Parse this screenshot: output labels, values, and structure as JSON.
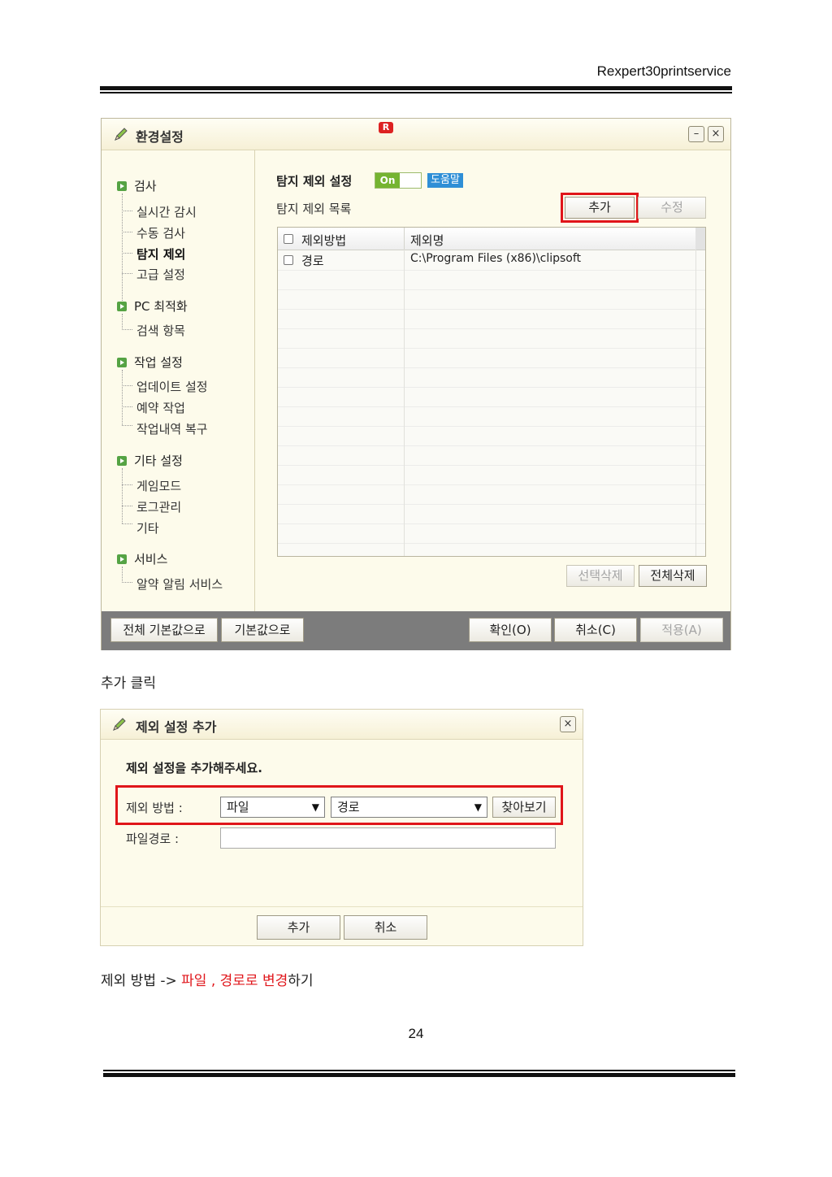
{
  "header": {
    "doc_title": "Rexpert30printservice"
  },
  "window1": {
    "title": "환경설정",
    "logo_letter": "R",
    "minimize_symbol": "–",
    "close_symbol": "×",
    "sidebar": {
      "groups": [
        {
          "label": "검사",
          "items": [
            "실시간 감시",
            "수동 검사",
            "탐지 제외",
            "고급 설정"
          ]
        },
        {
          "label": "PC 최적화",
          "items": [
            "검색 항목"
          ]
        },
        {
          "label": "작업 설정",
          "items": [
            "업데이트 설정",
            "예약 작업",
            "작업내역 복구"
          ]
        },
        {
          "label": "기타 설정",
          "items": [
            "게임모드",
            "로그관리",
            "기타"
          ]
        },
        {
          "label": "서비스",
          "items": [
            "알약 알림 서비스"
          ]
        }
      ],
      "active_item": "탐지 제외"
    },
    "main": {
      "section_title": "탐지 제외 설정",
      "toggle_label": "On",
      "help_label": "도움말",
      "list_label": "탐지 제외 목록",
      "add_button": "추가",
      "edit_button": "수정",
      "table": {
        "headers": [
          "제외방법",
          "제외명"
        ],
        "rows": [
          {
            "method": "경로",
            "name": "C:\\Program Files (x86)\\clipsoft"
          }
        ]
      },
      "delete_selected_button": "선택삭제",
      "delete_all_button": "전체삭제"
    },
    "footer": {
      "reset_all_button": "전체 기본값으로",
      "reset_button": "기본값으로",
      "ok_button": "확인(O)",
      "cancel_button": "취소(C)",
      "apply_button": "적용(A)"
    }
  },
  "caption1": "추가 클릭",
  "window2": {
    "title": "제외 설정 추가",
    "close_symbol": "×",
    "instruction": "제외 설정을 추가해주세요.",
    "method_label": "제외 방법 :",
    "method_select_value": "파일",
    "type_select_value": "경로",
    "browse_button": "찾아보기",
    "path_label": "파일경로 :",
    "path_value": "",
    "add_button": "추가",
    "cancel_button": "취소"
  },
  "caption2": {
    "prefix": "제외 방법 -> ",
    "highlight": "파일 , 경로로 변경",
    "suffix": "하기"
  },
  "page_number": "24",
  "colors": {
    "highlight_red": "#e0151a",
    "toggle_green": "#75b431",
    "help_blue": "#2f8fd6",
    "window_bg": "#fdfbeb"
  }
}
